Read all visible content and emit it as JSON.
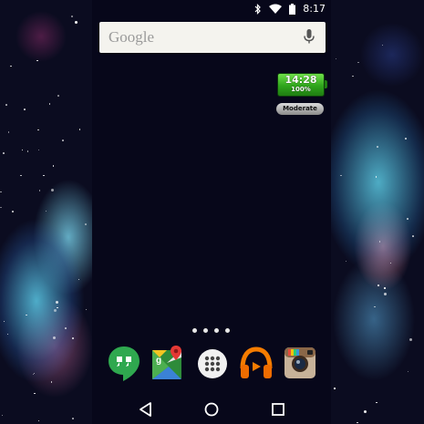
{
  "status_bar": {
    "time": "8:17",
    "icons": [
      "bluetooth-icon",
      "wifi-icon",
      "battery-icon"
    ]
  },
  "search_widget": {
    "logo_text": "Google",
    "mic_icon": "mic-icon"
  },
  "battery_widget": {
    "time": "14:28",
    "percent": "100%",
    "mode_label": "Moderate"
  },
  "page_indicator": {
    "pages": 4
  },
  "dock": {
    "apps": [
      {
        "name": "Hangouts",
        "icon": "hangouts-icon"
      },
      {
        "name": "Maps",
        "icon": "maps-icon"
      },
      {
        "name": "App drawer",
        "icon": "app-drawer-icon"
      },
      {
        "name": "Play Music",
        "icon": "play-music-icon"
      },
      {
        "name": "Instagram",
        "icon": "instagram-icon"
      }
    ]
  },
  "nav_bar": {
    "buttons": [
      "back-icon",
      "home-icon",
      "recents-icon"
    ]
  },
  "colors": {
    "screen_bg": "#07071a",
    "search_bg": "#f4f3ee",
    "battery_green": "#2fa51c"
  }
}
